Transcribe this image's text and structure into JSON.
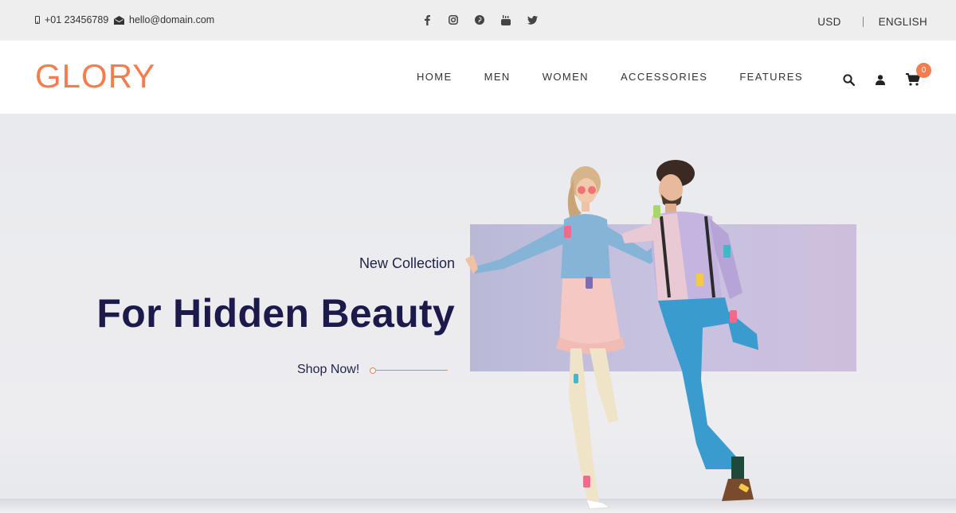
{
  "topbar": {
    "phone": "+01 23456789",
    "email": "hello@domain.com",
    "socials": [
      "facebook-icon",
      "instagram-icon",
      "pinterest-icon",
      "youtube-icon",
      "twitter-icon"
    ],
    "currency": "USD",
    "language": "ENGLISH"
  },
  "header": {
    "logo": "GLORY",
    "nav": [
      "HOME",
      "MEN",
      "WOMEN",
      "ACCESSORIES",
      "FEATURES"
    ],
    "icons": [
      "search-icon",
      "user-icon",
      "cart-icon"
    ],
    "cart_count": "0"
  },
  "hero": {
    "eyebrow": "New Collection",
    "title": "For Hidden Beauty",
    "cta": "Shop Now!"
  },
  "colors": {
    "accent": "#f27e4f",
    "title": "#1b1a4a",
    "topbar_bg": "#eeeeee"
  }
}
